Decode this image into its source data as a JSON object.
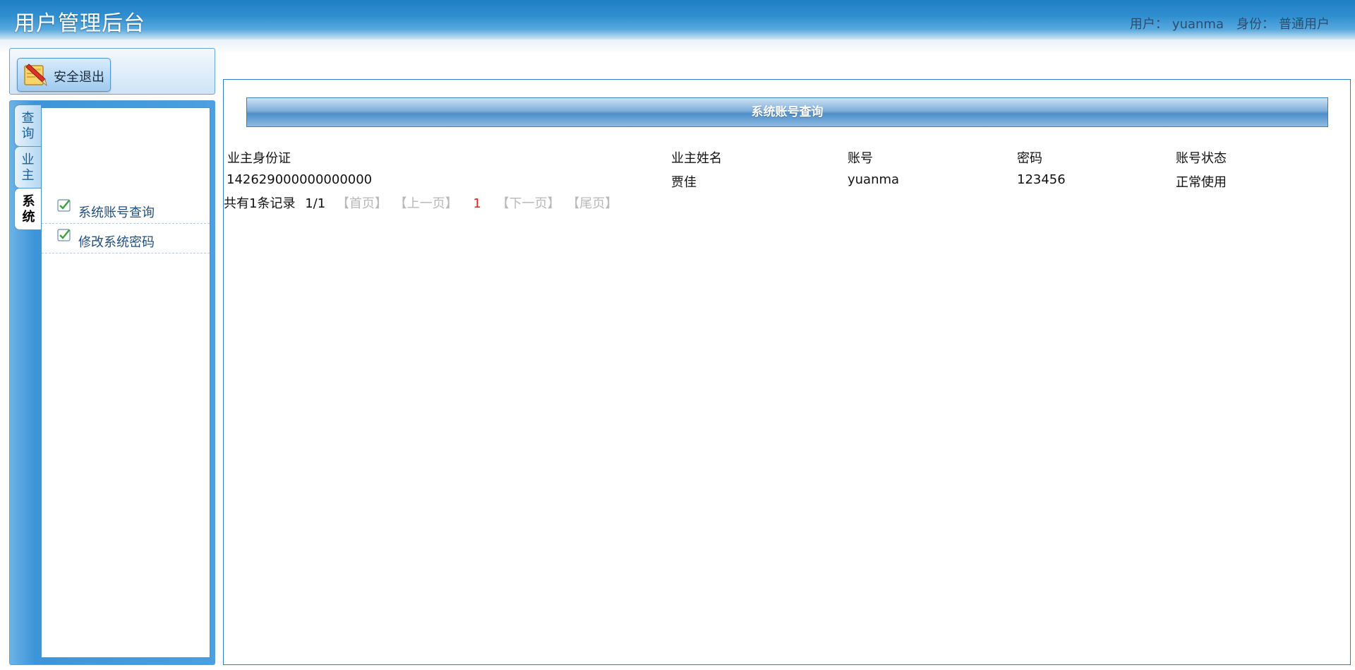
{
  "header": {
    "title": "用户管理后台",
    "user_label": "用户：",
    "username": "yuanma",
    "role_label": "身份：",
    "role": "普通用户"
  },
  "sidebar": {
    "logout_label": "安全退出",
    "tabs": [
      {
        "label": "查询",
        "active": false
      },
      {
        "label": "业主",
        "active": false
      },
      {
        "label": "系统",
        "active": true
      }
    ],
    "items": [
      {
        "label": "系统账号查询"
      },
      {
        "label": "修改系统密码"
      }
    ]
  },
  "main": {
    "section_title": "系统账号查询",
    "columns": [
      "业主身份证",
      "业主姓名",
      "账号",
      "密码",
      "账号状态"
    ],
    "rows": [
      [
        "142629000000000000",
        "贾佳",
        "yuanma",
        "123456",
        "正常使用"
      ]
    ],
    "pager": {
      "summary": "共有1条记录",
      "page_info": "1/1",
      "first": "【首页】",
      "prev": "【上一页】",
      "current": "1",
      "next": "【下一页】",
      "last": "【尾页】"
    }
  },
  "colors": {
    "header_blue": "#2f8fd0",
    "panel_blue": "#3d95d9",
    "banner_blue": "#4e8ec8",
    "link_disabled": "#b8b8b8",
    "current_page": "#e02020"
  }
}
